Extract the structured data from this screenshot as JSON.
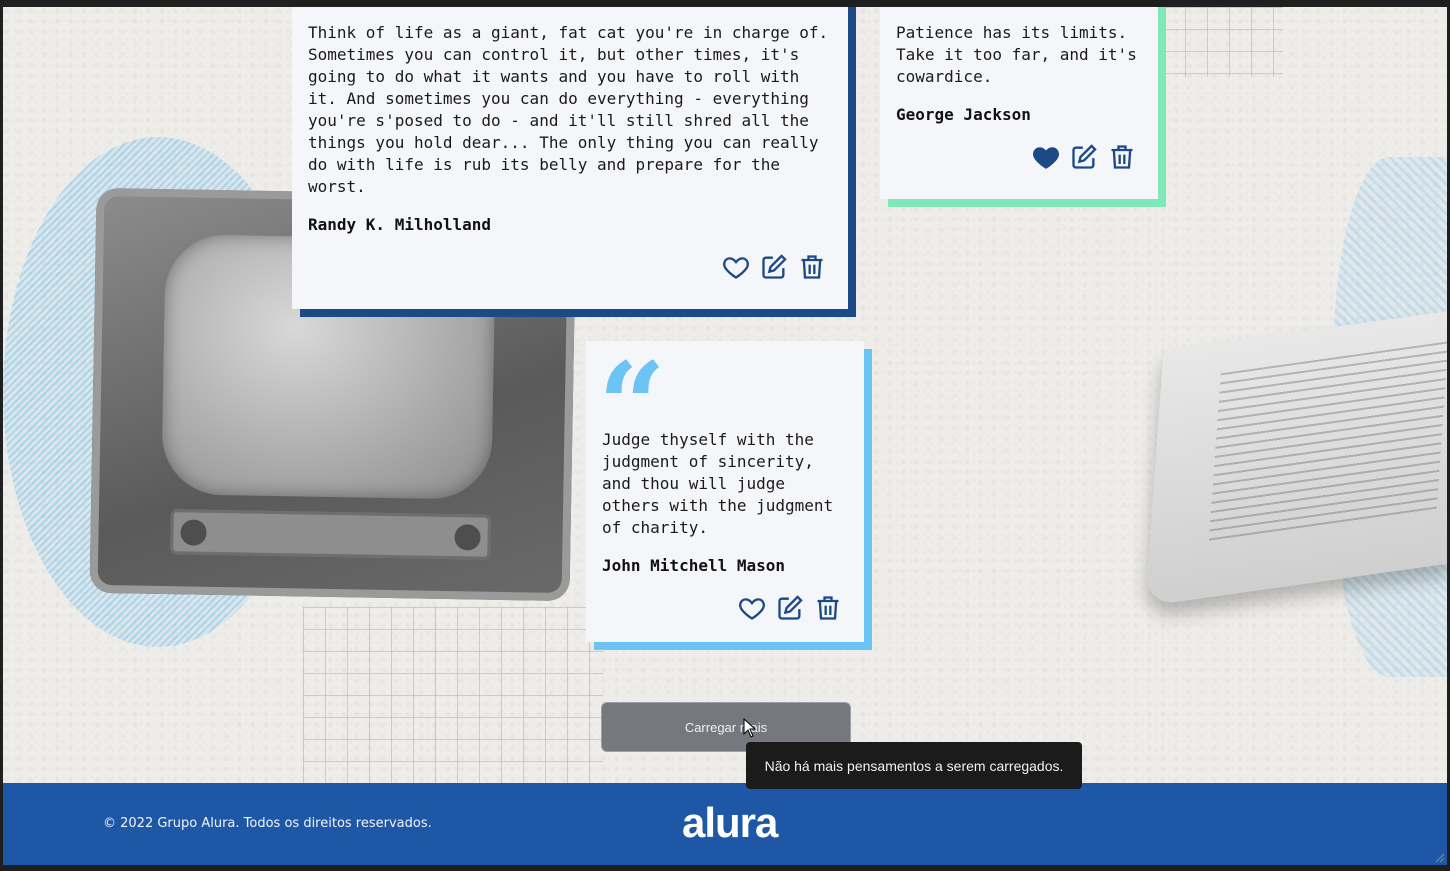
{
  "colors": {
    "dark_blue": "#1b4a86",
    "green": "#7fe8b8",
    "light_blue": "#6cc4f4",
    "footer_bg": "#1d57a6",
    "icon_color": "#1b4a86"
  },
  "cards": [
    {
      "text": "Think of life as a giant, fat cat you're in charge of.\nSometimes you can control it, but other times, it's\ngoing to do what it wants and you have to roll with\nit. And sometimes you can do everything - everything\nyou're s'posed to do - and it'll still shred all the\nthings you hold dear... The only thing you can really\ndo with life is rub its belly and prepare for the\nworst.",
      "author": "Randy K. Milholland",
      "favorited": false,
      "icons": [
        "heart-outline-icon",
        "edit-icon",
        "trash-icon"
      ]
    },
    {
      "text": "Patience has its limits.\nTake it too far, and it's\ncowardice.",
      "author": "George Jackson",
      "favorited": true,
      "icons": [
        "heart-filled-icon",
        "edit-icon",
        "trash-icon"
      ]
    },
    {
      "quote_mark": "“",
      "text": "Judge thyself with the\njudgment of sincerity,\nand thou will judge\nothers with the judgment\nof charity.",
      "author": "John Mitchell Mason",
      "favorited": false,
      "icons": [
        "heart-outline-icon",
        "edit-icon",
        "trash-icon"
      ]
    }
  ],
  "load_more": {
    "label": "Carregar mais"
  },
  "tooltip": {
    "text": "Não há mais pensamentos a serem carregados."
  },
  "footer": {
    "copyright": "© 2022 Grupo Alura. Todos os direitos reservados.",
    "logo": "alura"
  }
}
